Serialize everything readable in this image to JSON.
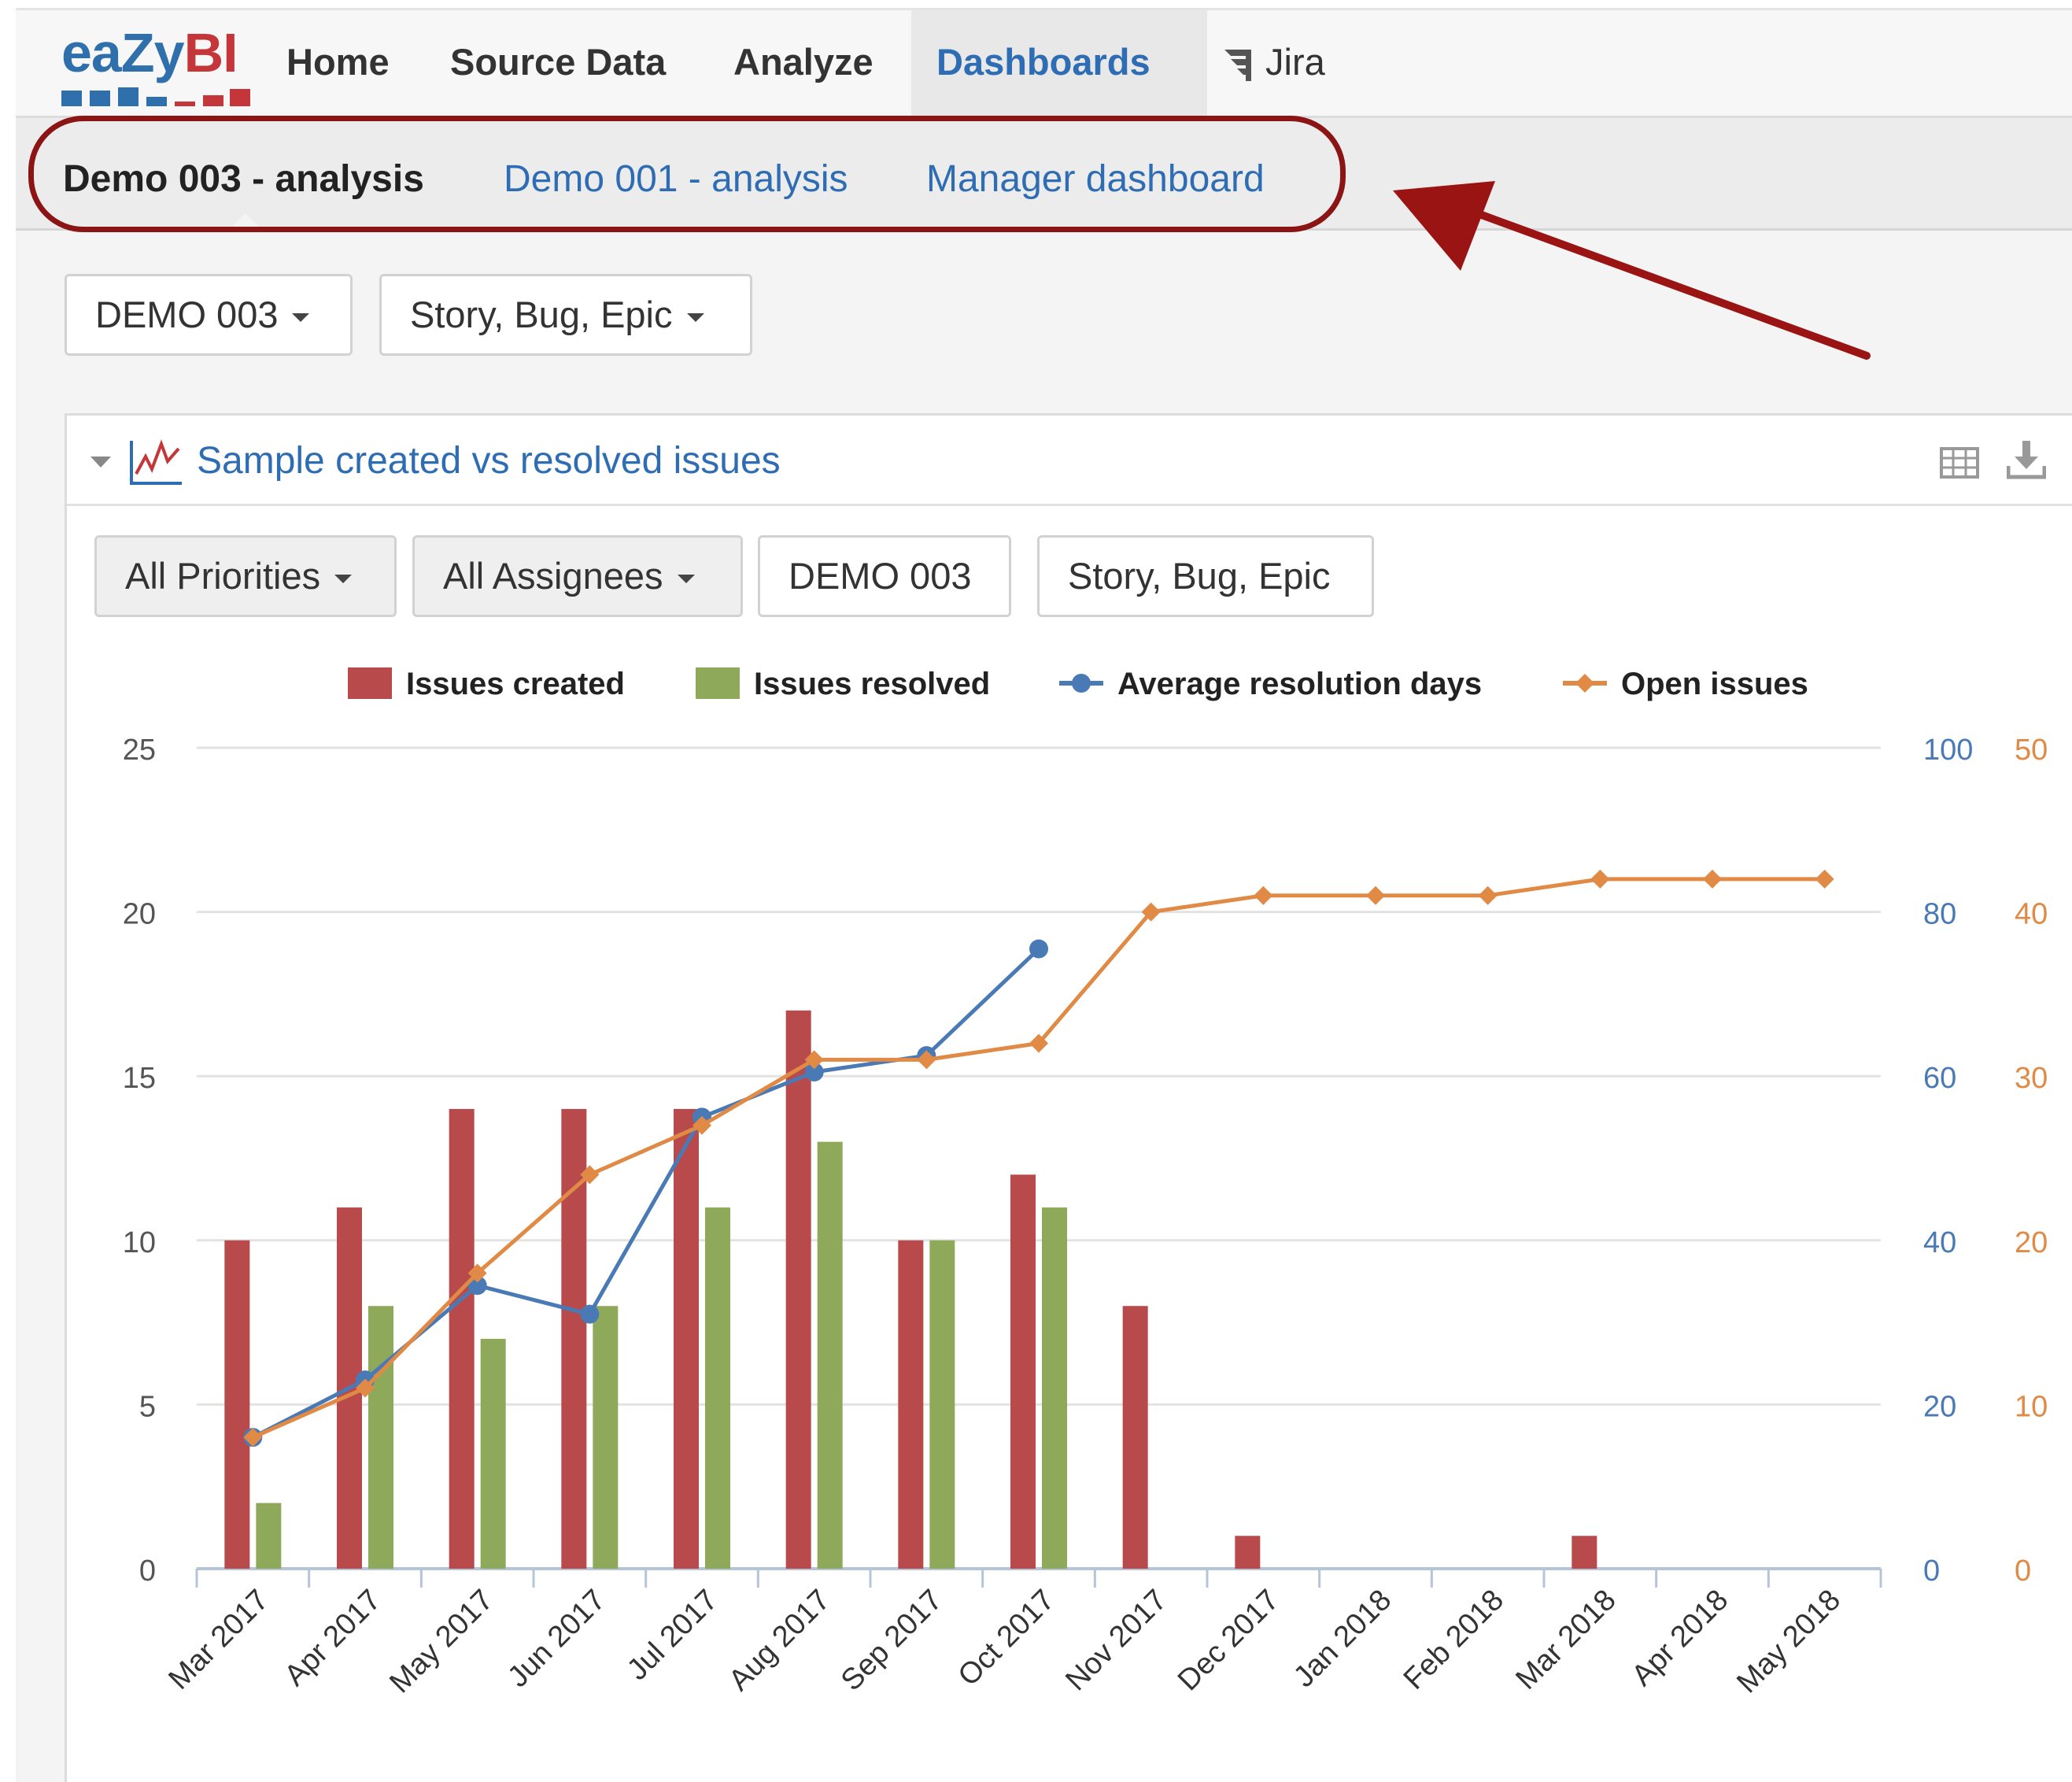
{
  "app": {
    "logo_text_a": "eaZy",
    "logo_text_b": "BI"
  },
  "nav": {
    "items": [
      "Home",
      "Source Data",
      "Analyze",
      "Dashboards"
    ],
    "active": "Dashboards",
    "jira_label": "Jira"
  },
  "dashboard_tabs": {
    "active": "Demo 003 - analysis",
    "others": [
      "Demo 001 - analysis",
      "Manager dashboard"
    ]
  },
  "page_filters": {
    "project": "DEMO 003",
    "issue_types": "Story, Bug, Epic"
  },
  "report": {
    "title": "Sample created vs resolved issues",
    "filters": {
      "priorities": "All Priorities",
      "assignees": "All Assignees",
      "project": "DEMO 003",
      "issue_types": "Story, Bug, Epic"
    }
  },
  "icons": {
    "logo": "eazybi-logo",
    "jira": "jira-icon",
    "chart": "line-chart-icon",
    "table": "table-icon",
    "download": "download-icon",
    "annotation": "red-arrow-annotation"
  },
  "colors": {
    "accent_link": "#2e6db3",
    "annotation": "#8b1414",
    "issues_created": "#b94a4c",
    "issues_resolved": "#8fa95a",
    "avg_resolution": "#4a7ab5",
    "open_issues": "#e08a45"
  },
  "chart_data": {
    "type": "bar",
    "categories": [
      "Mar 2017",
      "Apr 2017",
      "May 2017",
      "Jun 2017",
      "Jul 2017",
      "Aug 2017",
      "Sep 2017",
      "Oct 2017",
      "Nov 2017",
      "Dec 2017",
      "Jan 2018",
      "Feb 2018",
      "Mar 2018",
      "Apr 2018",
      "May 2018"
    ],
    "series": [
      {
        "name": "Issues created",
        "type": "bar",
        "axis": "left",
        "values": [
          10,
          11,
          14,
          14,
          14,
          17,
          10,
          12,
          8,
          1,
          0,
          0,
          1,
          0,
          0
        ]
      },
      {
        "name": "Issues resolved",
        "type": "bar",
        "axis": "left",
        "values": [
          2,
          8,
          7,
          8,
          11,
          13,
          10,
          11,
          0,
          0,
          0,
          0,
          0,
          0,
          0
        ]
      },
      {
        "name": "Average resolution days",
        "type": "line",
        "axis": "right1",
        "values": [
          16,
          23,
          34.5,
          31,
          55,
          60.5,
          62.5,
          75.5,
          null,
          null,
          null,
          null,
          null,
          null,
          null
        ]
      },
      {
        "name": "Open issues",
        "type": "line",
        "axis": "right2",
        "values": [
          8,
          11,
          18,
          24,
          27,
          31,
          31,
          32,
          40,
          41,
          41,
          41,
          42,
          42,
          42
        ]
      }
    ],
    "axes": {
      "left": {
        "ticks": [
          "0",
          "5",
          "10",
          "15",
          "20",
          "25"
        ],
        "ylim": [
          0,
          25
        ]
      },
      "right1": {
        "ticks": [
          "0",
          "20",
          "40",
          "60",
          "80",
          "100"
        ],
        "ylim": [
          0,
          100
        ]
      },
      "right2": {
        "ticks": [
          "0",
          "10",
          "20",
          "30",
          "40",
          "50"
        ],
        "ylim": [
          0,
          50
        ]
      }
    },
    "grid": true,
    "legend_position": "top"
  }
}
